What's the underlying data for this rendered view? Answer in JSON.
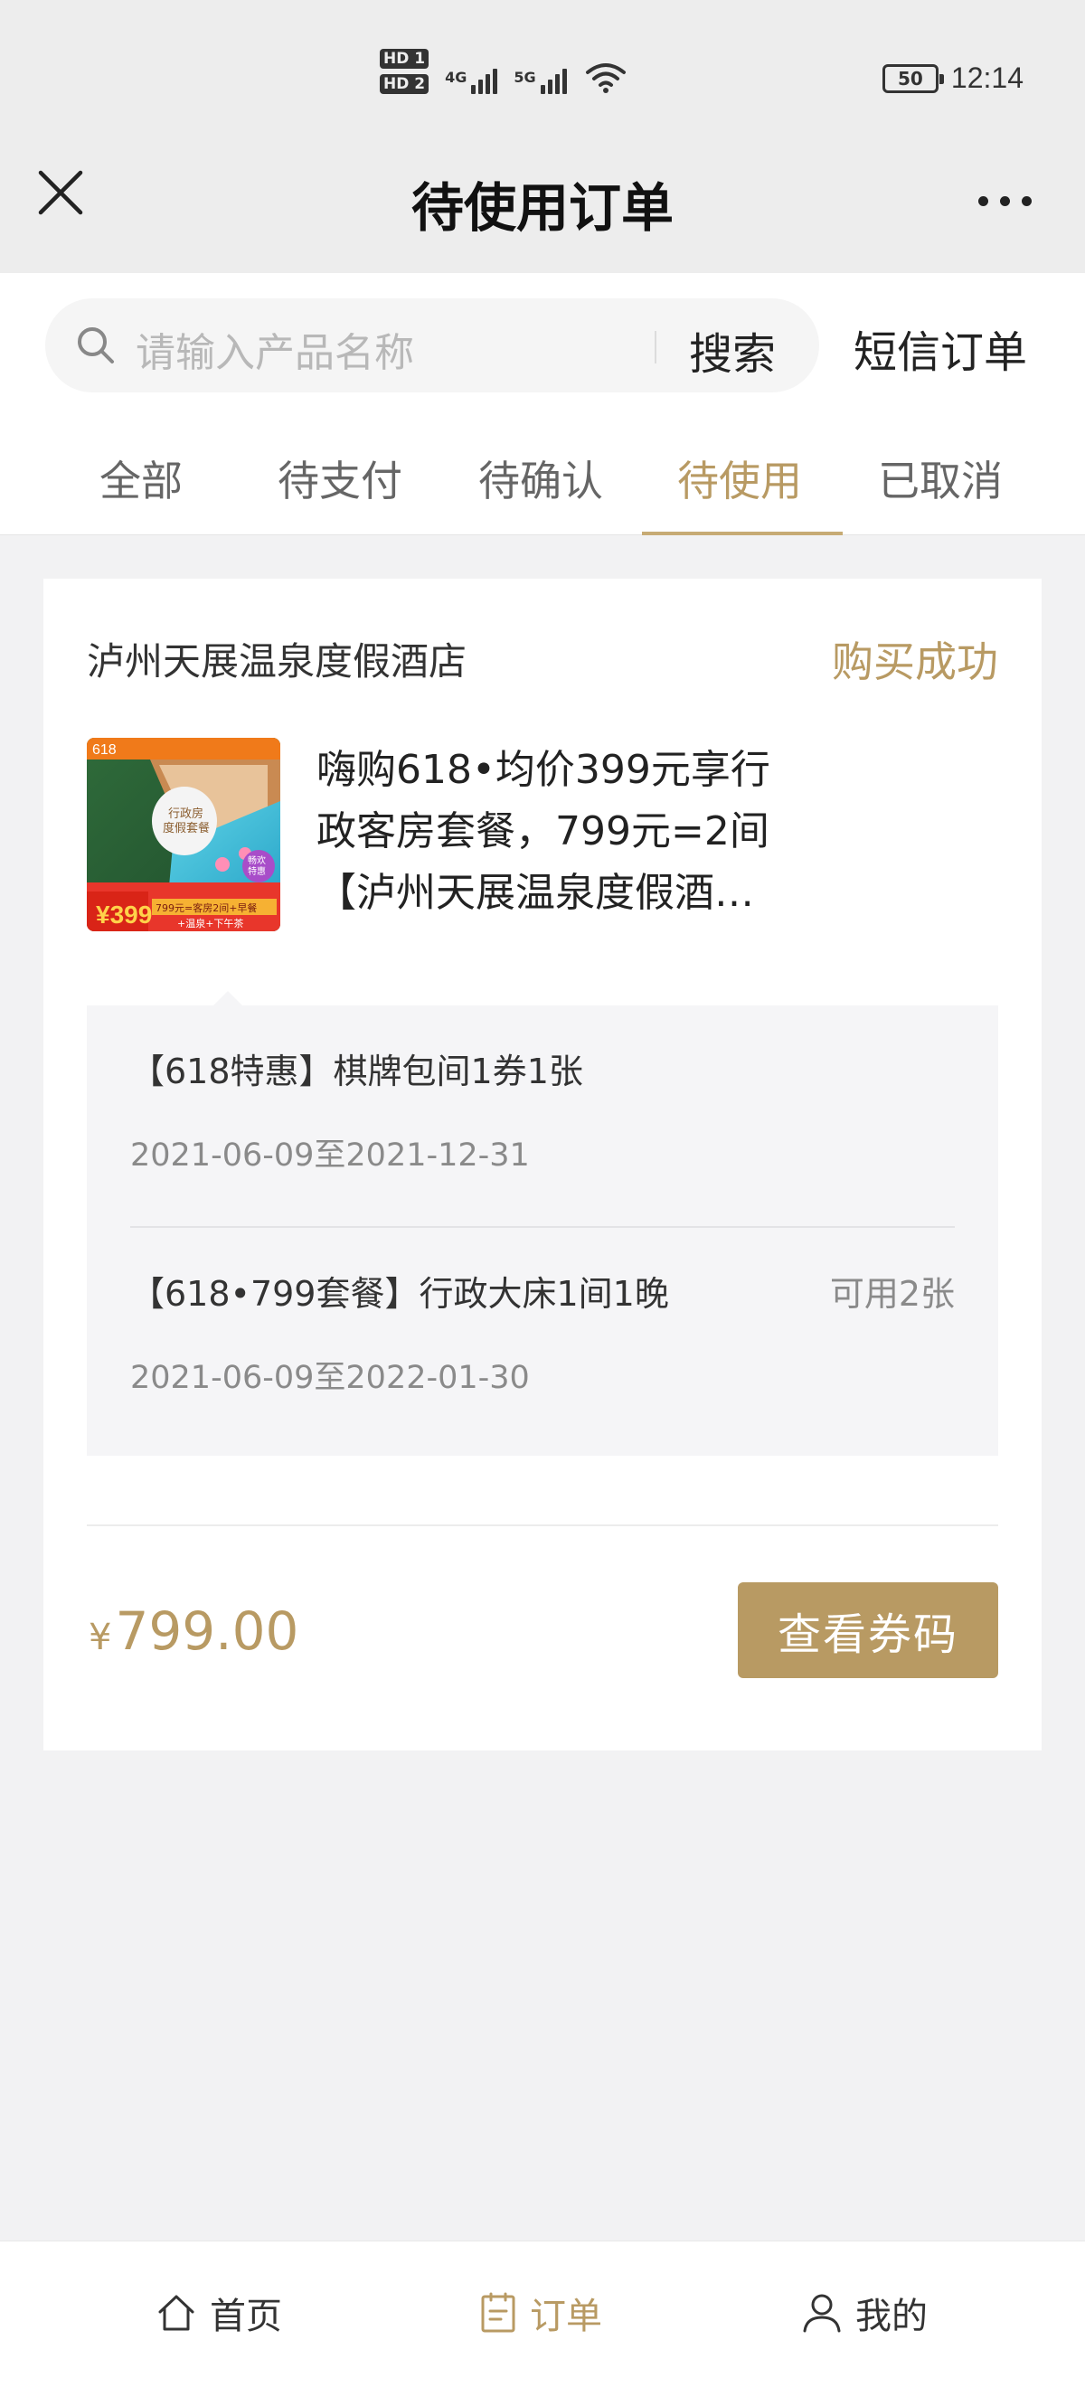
{
  "status_bar": {
    "sim1": "HD 1",
    "sim2": "HD 2",
    "net1": "4G",
    "net2": "5G",
    "battery": "50",
    "time": "12:14"
  },
  "nav_bar": {
    "title": "待使用订单",
    "close_icon": "close-icon",
    "more_icon": "more-icon"
  },
  "search": {
    "placeholder": "请输入产品名称",
    "button": "搜索",
    "sms_orders": "短信订单"
  },
  "tabs": [
    {
      "label": "全部",
      "active": false
    },
    {
      "label": "待支付",
      "active": false
    },
    {
      "label": "待确认",
      "active": false
    },
    {
      "label": "待使用",
      "active": true
    },
    {
      "label": "已取消",
      "active": false
    }
  ],
  "order": {
    "shop_name": "泸州天展温泉度假酒店",
    "status": "购买成功",
    "product_title_lines": [
      "嗨购618•均价399元享行",
      "政客房套餐，799元=2间",
      "【泸州天展温泉度假酒…"
    ],
    "thumbnail": {
      "tag": "618",
      "price": "399",
      "promo": "799元=客房2间+早餐",
      "promo2": "+温泉+下午茶"
    },
    "items": [
      {
        "name": "【618特惠】棋牌包间1券1张",
        "date": "2021-06-09至2021-12-31",
        "avail": ""
      },
      {
        "name": "【618•799套餐】行政大床1间1晚",
        "date": "2021-06-09至2022-01-30",
        "avail": "可用2张"
      }
    ],
    "currency": "¥",
    "price": "799.00",
    "view_code_button": "查看券码"
  },
  "bottom_nav": [
    {
      "label": "首页",
      "icon": "home-icon",
      "active": false
    },
    {
      "label": "订单",
      "icon": "order-icon",
      "active": true
    },
    {
      "label": "我的",
      "icon": "user-icon",
      "active": false
    }
  ],
  "colors": {
    "accent": "#b89a63",
    "background": "#f2f2f3",
    "statusbar": "#ededed"
  }
}
